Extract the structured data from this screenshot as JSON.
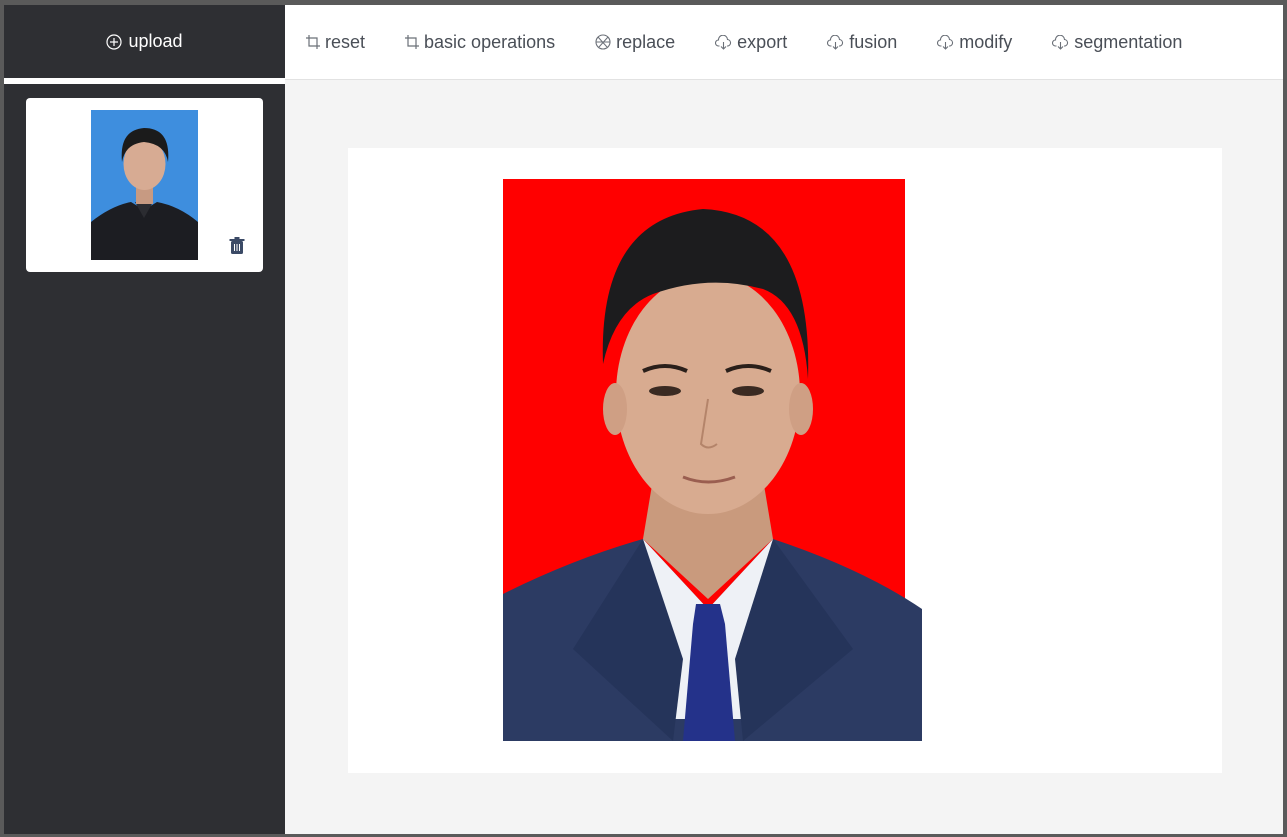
{
  "sidebar": {
    "upload_label": "upload",
    "upload_icon": "plus-circle-icon",
    "thumbnail_alt": "id photo thumbnail blue background",
    "thumbnail_bg": "#3e8ede",
    "delete_icon": "trash-icon"
  },
  "toolbar": {
    "items": [
      {
        "label": "reset",
        "icon": "crop-icon"
      },
      {
        "label": "basic operations",
        "icon": "crop-icon"
      },
      {
        "label": "replace",
        "icon": "aperture-icon"
      },
      {
        "label": "export",
        "icon": "cloud-download-icon"
      },
      {
        "label": "fusion",
        "icon": "cloud-download-icon"
      },
      {
        "label": "modify",
        "icon": "cloud-download-icon"
      },
      {
        "label": "segmentation",
        "icon": "cloud-download-icon"
      }
    ]
  },
  "canvas": {
    "photo_alt": "id photo red background",
    "photo_bg": "#ff0000"
  },
  "colors": {
    "sidebar": "#2e2f33",
    "workspace": "#f4f4f4",
    "toolbar_text": "#4a4f57"
  }
}
